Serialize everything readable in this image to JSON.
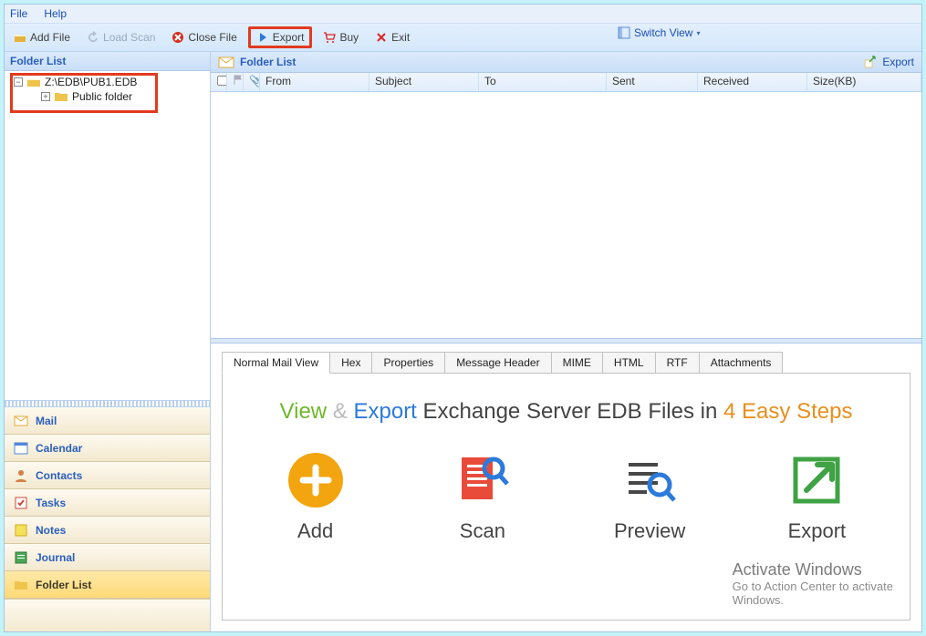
{
  "menu": {
    "file": "File",
    "help": "Help"
  },
  "toolbar": {
    "add_file": "Add File",
    "load_scan": "Load Scan",
    "close_file": "Close File",
    "export": "Export",
    "buy": "Buy",
    "exit": "Exit",
    "switch_view": "Switch View"
  },
  "left": {
    "header": "Folder List",
    "tree": {
      "root_label": "Z:\\EDB\\PUB1.EDB",
      "child_label": "Public folder"
    },
    "nav": {
      "mail": "Mail",
      "calendar": "Calendar",
      "contacts": "Contacts",
      "tasks": "Tasks",
      "notes": "Notes",
      "journal": "Journal",
      "folder_list": "Folder List"
    }
  },
  "right": {
    "header": "Folder List",
    "export_link": "Export",
    "columns": {
      "from": "From",
      "subject": "Subject",
      "to": "To",
      "sent": "Sent",
      "received": "Received",
      "size": "Size(KB)"
    },
    "tabs": {
      "normal": "Normal Mail View",
      "hex": "Hex",
      "properties": "Properties",
      "message_header": "Message Header",
      "mime": "MIME",
      "html": "HTML",
      "rtf": "RTF",
      "attachments": "Attachments"
    },
    "hero": {
      "view": "View",
      "amp": "&",
      "export": "Export",
      "rest1": "Exchange Server EDB Files",
      "in": "in",
      "steps": "4 Easy Steps"
    },
    "steps": {
      "add": "Add",
      "scan": "Scan",
      "preview": "Preview",
      "export": "Export"
    }
  },
  "watermark": {
    "title": "Activate Windows",
    "body1": "Go to Action Center to activate",
    "body2": "Windows."
  }
}
